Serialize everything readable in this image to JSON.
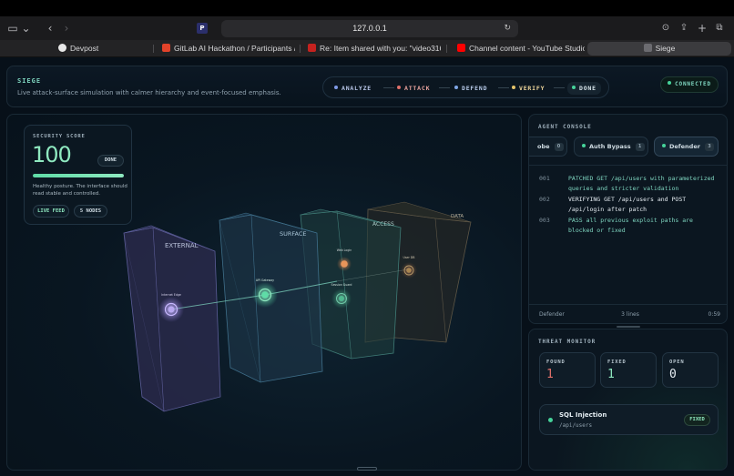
{
  "browser": {
    "url": "127.0.0.1",
    "tabs": [
      {
        "label": "Devpost",
        "icon_color": "#e8e8e8"
      },
      {
        "label": "GitLab AI Hackathon / Participants / ta...",
        "icon_color": "#e2432a"
      },
      {
        "label": "Re: Item shared with you: \"video3164...",
        "icon_color": "#c5221f"
      },
      {
        "label": "Channel content - YouTube Studio",
        "icon_color": "#ff0000"
      },
      {
        "label": "Siege",
        "icon_color": "#6b6b70"
      }
    ]
  },
  "header": {
    "brand": "SIEGE",
    "subtitle": "Live attack-surface simulation with calmer hierarchy and event-focused emphasis.",
    "phases": [
      {
        "label": "ANALYZE",
        "color": "#7f9ae6"
      },
      {
        "label": "ATTACK",
        "color": "#e0706a"
      },
      {
        "label": "DEFEND",
        "color": "#7fa6e6"
      },
      {
        "label": "VERIFY",
        "color": "#e6c46a"
      },
      {
        "label": "DONE",
        "color": "#46d39a"
      }
    ],
    "status": "CONNECTED"
  },
  "score": {
    "label": "SECURITY SCORE",
    "value": "100",
    "fraction": 1.0,
    "badge": "DONE",
    "description": "Healthy posture. The interface should read stable and controlled.",
    "chips": [
      "LIVE FEED",
      "5 NODES"
    ]
  },
  "scene": {
    "layers": [
      "EXTERNAL",
      "SURFACE",
      "ACCESS",
      "DATA"
    ],
    "nodes": [
      "Internet Edge",
      "API Gateway",
      "Web Login",
      "Session Guard",
      "User DB"
    ]
  },
  "console": {
    "title": "AGENT CONSOLE",
    "agents": [
      {
        "label": "obe",
        "count": "0"
      },
      {
        "label": "Auth Bypass",
        "count": "1"
      },
      {
        "label": "Defender",
        "count": "3"
      }
    ],
    "logs": [
      {
        "num": "001",
        "text": "PATCHED GET /api/users with parameterized queries and stricter validation",
        "color": "#7fd6c0"
      },
      {
        "num": "002",
        "text": "VERIFYING GET /api/users and POST /api/login after patch",
        "color": "#e6edf2"
      },
      {
        "num": "003",
        "text": "PASS all previous exploit paths are blocked or fixed",
        "color": "#7fd6c0"
      }
    ],
    "footer": {
      "agent": "Defender",
      "lines": "3 lines",
      "time": "0:59"
    }
  },
  "threat": {
    "title": "THREAT MONITOR",
    "stats": [
      {
        "label": "FOUND",
        "value": "1",
        "color": "#e0706a"
      },
      {
        "label": "FIXED",
        "value": "1",
        "color": "#8fe9c0"
      },
      {
        "label": "OPEN",
        "value": "0",
        "color": "#e6edf2"
      }
    ],
    "vuln": {
      "name": "SQL Injection",
      "path": "/api/users",
      "badge": "FIXED"
    }
  }
}
